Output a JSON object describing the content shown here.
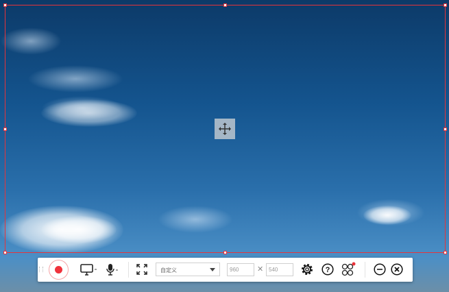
{
  "toolbar": {
    "region_preset": "自定义",
    "width_value": "960",
    "height_value": "540",
    "times_symbol": "✕"
  },
  "colors": {
    "accent": "#e8333a",
    "record": "#f0323c"
  }
}
